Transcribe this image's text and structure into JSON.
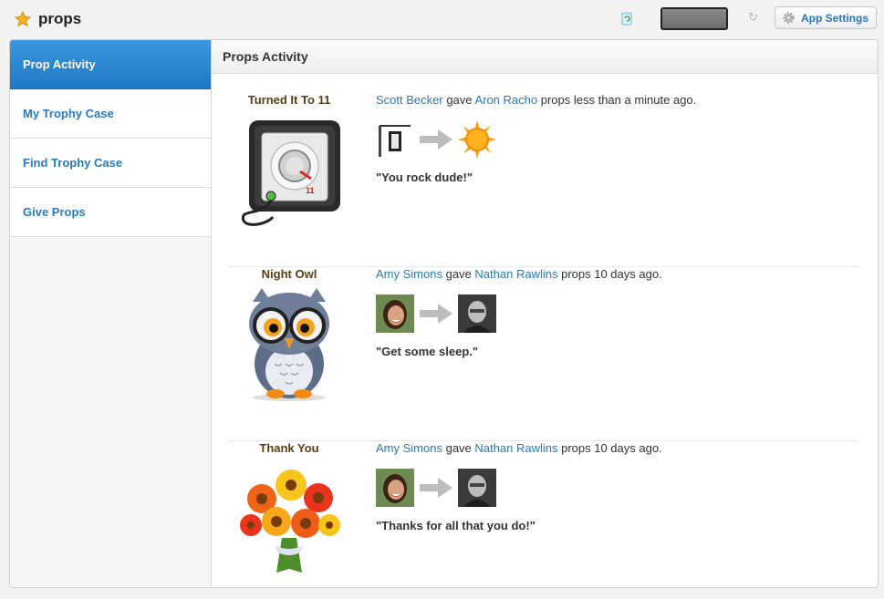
{
  "app": {
    "title": "props"
  },
  "toolbar": {
    "settings_label": "App Settings"
  },
  "sidebar": {
    "items": [
      {
        "label": "Prop Activity",
        "active": true
      },
      {
        "label": "My Trophy Case",
        "active": false
      },
      {
        "label": "Find Trophy Case",
        "active": false
      },
      {
        "label": "Give Props",
        "active": false
      }
    ]
  },
  "main": {
    "header": "Props Activity",
    "activities": [
      {
        "trophy": "Turned It To 11",
        "giver": "Scott Becker",
        "verb": "gave",
        "receiver": "Aron Racho",
        "suffix": "props less than a minute ago.",
        "message": "\"You rock dude!\""
      },
      {
        "trophy": "Night Owl",
        "giver": "Amy Simons",
        "verb": "gave",
        "receiver": "Nathan Rawlins",
        "suffix": "props 10 days ago.",
        "message": "\"Get some sleep.\""
      },
      {
        "trophy": "Thank You",
        "giver": "Amy Simons",
        "verb": "gave",
        "receiver": "Nathan Rawlins",
        "suffix": "props 10 days ago.",
        "message": "\"Thanks for all that you do!\""
      }
    ]
  },
  "colors": {
    "link": "#2a7ab8",
    "active_nav": "#2b86d0",
    "trophy_title": "#5a3d10"
  },
  "icons": [
    "star-icon",
    "recycle-icon",
    "refresh-icon",
    "gear-icon",
    "amp-trophy-icon",
    "owl-trophy-icon",
    "bouquet-trophy-icon",
    "arrow-right-icon"
  ]
}
